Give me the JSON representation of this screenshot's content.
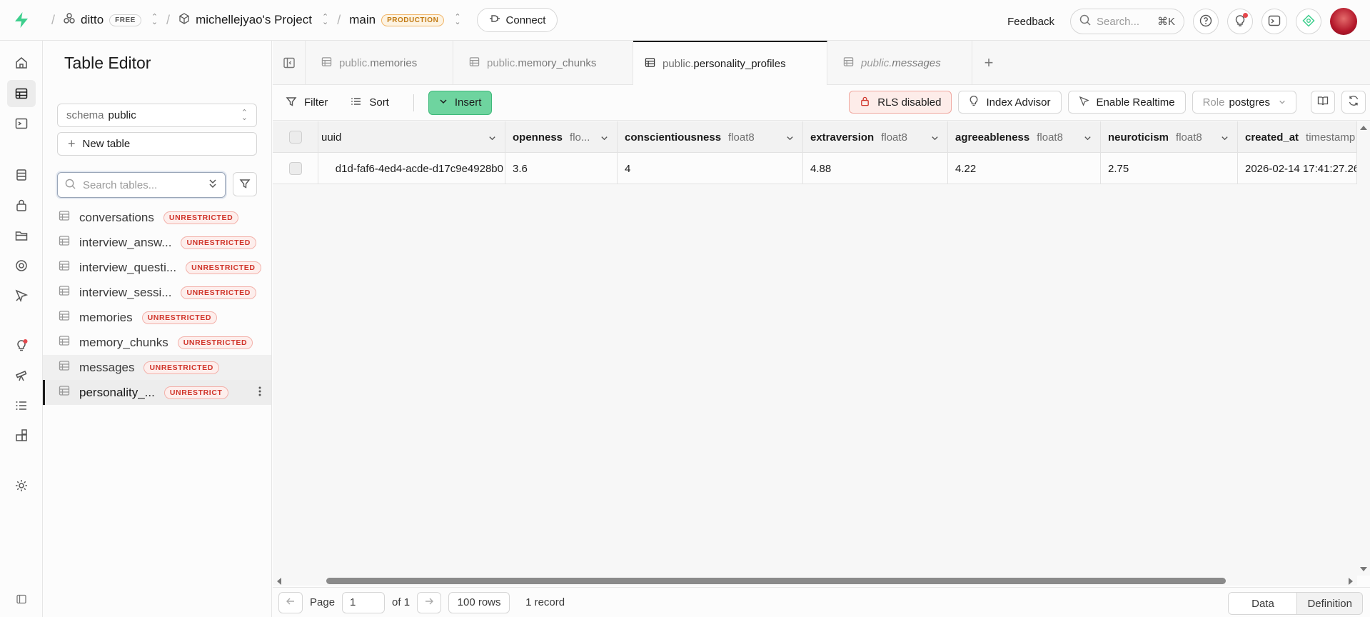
{
  "topbar": {
    "org": "ditto",
    "org_plan": "FREE",
    "project": "michellejyao's Project",
    "branch": "main",
    "branch_badge": "PRODUCTION",
    "connect_label": "Connect",
    "feedback_label": "Feedback",
    "search_placeholder": "Search...",
    "search_shortcut": "⌘K"
  },
  "sidebar": {
    "title": "Table Editor",
    "schema_label": "schema",
    "schema_value": "public",
    "new_table_label": "New table",
    "search_placeholder": "Search tables...",
    "tables": [
      {
        "name": "conversations",
        "badge": "UNRESTRICTED"
      },
      {
        "name": "interview_answ...",
        "badge": "UNRESTRICTED"
      },
      {
        "name": "interview_questi...",
        "badge": "UNRESTRICTED"
      },
      {
        "name": "interview_sessi...",
        "badge": "UNRESTRICTED"
      },
      {
        "name": "memories",
        "badge": "UNRESTRICTED"
      },
      {
        "name": "memory_chunks",
        "badge": "UNRESTRICTED"
      },
      {
        "name": "messages",
        "badge": "UNRESTRICTED"
      },
      {
        "name": "personality_...",
        "badge": "UNRESTRICT"
      }
    ]
  },
  "tabs": [
    {
      "prefix": "public.",
      "name": "memories"
    },
    {
      "prefix": "public.",
      "name": "memory_chunks"
    },
    {
      "prefix": "public.",
      "name": "personality_profiles"
    },
    {
      "prefix": "public.",
      "name": "messages"
    }
  ],
  "toolbar": {
    "filter_label": "Filter",
    "sort_label": "Sort",
    "insert_label": "Insert",
    "rls_label": "RLS disabled",
    "index_advisor_label": "Index Advisor",
    "realtime_label": "Enable Realtime",
    "role_label": "Role",
    "role_value": "postgres"
  },
  "grid": {
    "columns": [
      {
        "name": "uuid",
        "type": ""
      },
      {
        "name": "openness",
        "type": "flo..."
      },
      {
        "name": "conscientiousness",
        "type": "float8"
      },
      {
        "name": "extraversion",
        "type": "float8"
      },
      {
        "name": "agreeableness",
        "type": "float8"
      },
      {
        "name": "neuroticism",
        "type": "float8"
      },
      {
        "name": "created_at",
        "type": "timestamp"
      }
    ],
    "rows": [
      [
        "d1d-faf6-4ed4-acde-d17c9e4928b0",
        "3.6",
        "4",
        "4.88",
        "4.22",
        "2.75",
        "2026-02-14 17:41:27.26"
      ]
    ]
  },
  "footer": {
    "page_label": "Page",
    "page_value": "1",
    "of_label": "of 1",
    "rows_label": "100 rows",
    "record_count": "1 record",
    "view_data": "Data",
    "view_definition": "Definition"
  },
  "colors": {
    "accent_green": "#6ed49f",
    "unrestricted_red": "#d0352b",
    "production_orange": "#c27a12"
  }
}
